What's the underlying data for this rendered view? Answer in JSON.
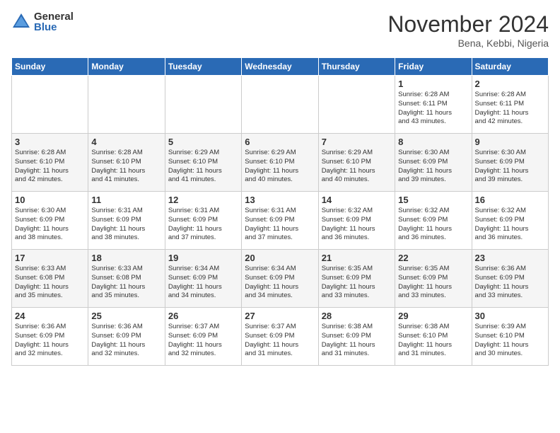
{
  "header": {
    "logo_general": "General",
    "logo_blue": "Blue",
    "month_title": "November 2024",
    "location": "Bena, Kebbi, Nigeria"
  },
  "days_of_week": [
    "Sunday",
    "Monday",
    "Tuesday",
    "Wednesday",
    "Thursday",
    "Friday",
    "Saturday"
  ],
  "weeks": [
    [
      {
        "day": "",
        "text": ""
      },
      {
        "day": "",
        "text": ""
      },
      {
        "day": "",
        "text": ""
      },
      {
        "day": "",
        "text": ""
      },
      {
        "day": "",
        "text": ""
      },
      {
        "day": "1",
        "text": "Sunrise: 6:28 AM\nSunset: 6:11 PM\nDaylight: 11 hours\nand 43 minutes."
      },
      {
        "day": "2",
        "text": "Sunrise: 6:28 AM\nSunset: 6:11 PM\nDaylight: 11 hours\nand 42 minutes."
      }
    ],
    [
      {
        "day": "3",
        "text": "Sunrise: 6:28 AM\nSunset: 6:10 PM\nDaylight: 11 hours\nand 42 minutes."
      },
      {
        "day": "4",
        "text": "Sunrise: 6:28 AM\nSunset: 6:10 PM\nDaylight: 11 hours\nand 41 minutes."
      },
      {
        "day": "5",
        "text": "Sunrise: 6:29 AM\nSunset: 6:10 PM\nDaylight: 11 hours\nand 41 minutes."
      },
      {
        "day": "6",
        "text": "Sunrise: 6:29 AM\nSunset: 6:10 PM\nDaylight: 11 hours\nand 40 minutes."
      },
      {
        "day": "7",
        "text": "Sunrise: 6:29 AM\nSunset: 6:10 PM\nDaylight: 11 hours\nand 40 minutes."
      },
      {
        "day": "8",
        "text": "Sunrise: 6:30 AM\nSunset: 6:09 PM\nDaylight: 11 hours\nand 39 minutes."
      },
      {
        "day": "9",
        "text": "Sunrise: 6:30 AM\nSunset: 6:09 PM\nDaylight: 11 hours\nand 39 minutes."
      }
    ],
    [
      {
        "day": "10",
        "text": "Sunrise: 6:30 AM\nSunset: 6:09 PM\nDaylight: 11 hours\nand 38 minutes."
      },
      {
        "day": "11",
        "text": "Sunrise: 6:31 AM\nSunset: 6:09 PM\nDaylight: 11 hours\nand 38 minutes."
      },
      {
        "day": "12",
        "text": "Sunrise: 6:31 AM\nSunset: 6:09 PM\nDaylight: 11 hours\nand 37 minutes."
      },
      {
        "day": "13",
        "text": "Sunrise: 6:31 AM\nSunset: 6:09 PM\nDaylight: 11 hours\nand 37 minutes."
      },
      {
        "day": "14",
        "text": "Sunrise: 6:32 AM\nSunset: 6:09 PM\nDaylight: 11 hours\nand 36 minutes."
      },
      {
        "day": "15",
        "text": "Sunrise: 6:32 AM\nSunset: 6:09 PM\nDaylight: 11 hours\nand 36 minutes."
      },
      {
        "day": "16",
        "text": "Sunrise: 6:32 AM\nSunset: 6:09 PM\nDaylight: 11 hours\nand 36 minutes."
      }
    ],
    [
      {
        "day": "17",
        "text": "Sunrise: 6:33 AM\nSunset: 6:08 PM\nDaylight: 11 hours\nand 35 minutes."
      },
      {
        "day": "18",
        "text": "Sunrise: 6:33 AM\nSunset: 6:08 PM\nDaylight: 11 hours\nand 35 minutes."
      },
      {
        "day": "19",
        "text": "Sunrise: 6:34 AM\nSunset: 6:09 PM\nDaylight: 11 hours\nand 34 minutes."
      },
      {
        "day": "20",
        "text": "Sunrise: 6:34 AM\nSunset: 6:09 PM\nDaylight: 11 hours\nand 34 minutes."
      },
      {
        "day": "21",
        "text": "Sunrise: 6:35 AM\nSunset: 6:09 PM\nDaylight: 11 hours\nand 33 minutes."
      },
      {
        "day": "22",
        "text": "Sunrise: 6:35 AM\nSunset: 6:09 PM\nDaylight: 11 hours\nand 33 minutes."
      },
      {
        "day": "23",
        "text": "Sunrise: 6:36 AM\nSunset: 6:09 PM\nDaylight: 11 hours\nand 33 minutes."
      }
    ],
    [
      {
        "day": "24",
        "text": "Sunrise: 6:36 AM\nSunset: 6:09 PM\nDaylight: 11 hours\nand 32 minutes."
      },
      {
        "day": "25",
        "text": "Sunrise: 6:36 AM\nSunset: 6:09 PM\nDaylight: 11 hours\nand 32 minutes."
      },
      {
        "day": "26",
        "text": "Sunrise: 6:37 AM\nSunset: 6:09 PM\nDaylight: 11 hours\nand 32 minutes."
      },
      {
        "day": "27",
        "text": "Sunrise: 6:37 AM\nSunset: 6:09 PM\nDaylight: 11 hours\nand 31 minutes."
      },
      {
        "day": "28",
        "text": "Sunrise: 6:38 AM\nSunset: 6:09 PM\nDaylight: 11 hours\nand 31 minutes."
      },
      {
        "day": "29",
        "text": "Sunrise: 6:38 AM\nSunset: 6:10 PM\nDaylight: 11 hours\nand 31 minutes."
      },
      {
        "day": "30",
        "text": "Sunrise: 6:39 AM\nSunset: 6:10 PM\nDaylight: 11 hours\nand 30 minutes."
      }
    ]
  ]
}
